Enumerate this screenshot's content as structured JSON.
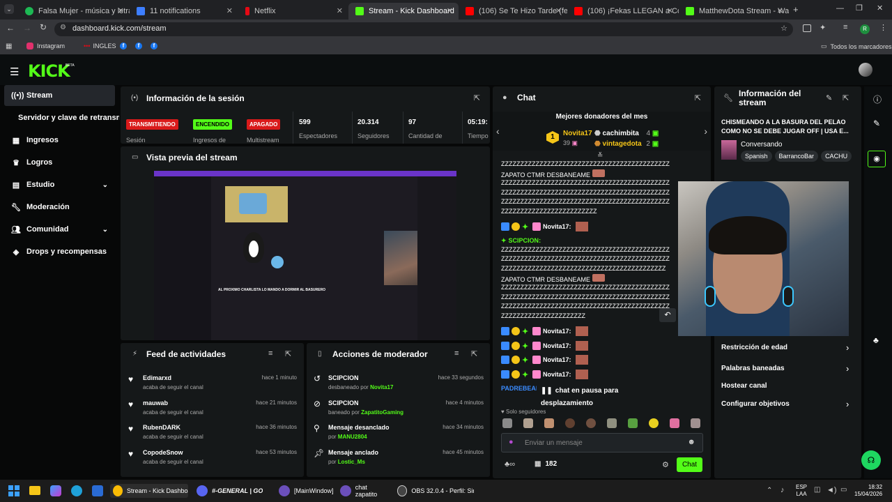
{
  "browser": {
    "tabs": [
      {
        "label": "Falsa Mujer - música y letra de",
        "color": "#1db954"
      },
      {
        "label": "11 notifications",
        "color": "#3d7eff"
      },
      {
        "label": "Netflix",
        "color": "#e50914"
      },
      {
        "label": "Stream - Kick Dashboard",
        "color": "#53fc18"
      },
      {
        "label": "(106) Se Te Hizo Tarde (feat. Ele",
        "color": "#ff0000"
      },
      {
        "label": "(106) ¡Fekas LLEGAN a Colo",
        "color": "#ff0000"
      },
      {
        "label": "MatthewDota Stream - Watch l",
        "color": "#53fc18"
      }
    ],
    "url": "dashboard.kick.com/stream",
    "bookmarks": [
      "Instagram",
      "INGLES"
    ],
    "bookmarks_right": "Todos los marcadores"
  },
  "brand": {
    "logo": "KICK",
    "beta": "BETA"
  },
  "sidebar": {
    "items": [
      {
        "label": "Stream",
        "icon": "broadcast-icon"
      },
      {
        "label": "Servidor y clave de retransmisión",
        "icon": ""
      },
      {
        "label": "Ingresos",
        "icon": "revenue-icon"
      },
      {
        "label": "Logros",
        "icon": "trophy-icon"
      },
      {
        "label": "Estudio",
        "icon": "studio-icon"
      },
      {
        "label": "Moderación",
        "icon": "wrench-icon"
      },
      {
        "label": "Comunidad",
        "icon": "community-icon"
      },
      {
        "label": "Drops y recompensas",
        "icon": "drops-icon"
      }
    ]
  },
  "session": {
    "title": "Información de la sesión",
    "status_badges": [
      {
        "badge": "TRANSMITIENDO",
        "label": "Sesión",
        "color": "#d91a1a"
      },
      {
        "badge": "ENCENDIDO",
        "label": "Ingresos de",
        "color": "#53fc18"
      },
      {
        "badge": "APAGADO",
        "label": "Multistream",
        "color": "#d91a1a"
      }
    ],
    "stats": [
      {
        "value": "599",
        "label": "Espectadores"
      },
      {
        "value": "20.314",
        "label": "Seguidores"
      },
      {
        "value": "97",
        "label": "Cantidad de"
      },
      {
        "value": "05:19:",
        "label": "Tiempo"
      }
    ]
  },
  "preview": {
    "title": "Vista previa del stream",
    "overlay_text": "AL PROXIMO CHARLISTA LO MANDO A DORMIR AL BASURERO"
  },
  "feed": {
    "title": "Feed de actividades",
    "rows": [
      {
        "name": "Edimarxd",
        "sub": "acaba de seguir el canal",
        "time": "hace 1 minuto"
      },
      {
        "name": "mauwab",
        "sub": "acaba de seguir el canal",
        "time": "hace 21 minutos"
      },
      {
        "name": "RubenDARK",
        "sub": "acaba de seguir el canal",
        "time": "hace 36 minutos"
      },
      {
        "name": "CopodeSnow",
        "sub": "acaba de seguir el canal",
        "time": "hace 53 minutos"
      }
    ]
  },
  "moderator": {
    "title": "Acciones de moderador",
    "rows": [
      {
        "name": "SCIPCION",
        "sub": "desbaneado por",
        "by": "Novita17",
        "time": "hace 33 segundos"
      },
      {
        "name": "SCIPCION",
        "sub": "baneado por",
        "by": "ZapatitoGaming",
        "time": "hace 4 minutos"
      },
      {
        "name": "Mensaje desanclado",
        "sub": "por",
        "by": "MANU2804",
        "time": "hace 34 minutos"
      },
      {
        "name": "Mensaje anclado",
        "sub": "por",
        "by": "Lostic_Ms",
        "time": "hace 45 minutos"
      }
    ]
  },
  "chat": {
    "title": "Chat",
    "donors_title": "Mejores donadores del mes",
    "donors": [
      {
        "name": "Novita17",
        "amount": "39"
      },
      {
        "name": "cachimbita",
        "amount": "4"
      },
      {
        "name": "vintagedota",
        "amount": "2"
      }
    ],
    "rank_badge": "1",
    "lines": [
      "ZZZZZZZZZZZZZZZZZZZZZZZZZZZZZZZZZZZZZZZZZZZZ",
      "ZAPATO CTMR DESBANEAME",
      "ZZZZZZZZZZZZZZZZZZZZZZZZZZZZZZZZZZZZZZZZZZZZ",
      "ZZZZZZZZZZZZZZZZZZZZZZZZZZZZZZZZZZZZZZZZZZZZ",
      "ZZZZZZZZZZZZZZZZZZZZZZZZZZZZZZZZZZZZZZZZZZZZ",
      "ZZZZZZZZZZZZZZZZZZZZZZZZZ"
    ],
    "mention": "SCIPCION",
    "lines2": [
      "ZZZZZZZZZZZZZZZZZZZZZZZZZZZZZZZZZZZZZZZZZZZZ",
      "ZZZZZZZZZZZZZZZZZZZZZZZZZZZZZZZZZZZZZZZZZZZZ",
      "ZZZZZZZZZZZZZZZZZZZZZZZZZZZZZZZZZZZZZZZZZZZ",
      "ZAPATO CTMR DESBANEAME",
      "ZZZZZZZZZZZZZZZZZZZZZZZZZZZZZZZZZZZZZZZZZZZZ",
      "ZZZZZZZZZZZZZZZZZZZZZZZZZZZZZZZZZZZZZZZZZZZZ",
      "ZZZZZZZZZZZZZZZZZZZZZZZZZZZZZZZZZZZZZZZZZZZZ",
      "ZZZZZZZZZZZZZZZZZZZZZZ"
    ],
    "user": "Novita17:",
    "partial_user": "PADREBEAR",
    "paused": "chat en pausa para desplazamiento",
    "followers_only": "Solo seguidores",
    "input_placeholder": "Enviar un mensaje",
    "count": "182",
    "send_label": "Chat"
  },
  "stream_info": {
    "title": "Información del stream",
    "stream_title": "CHISMEANDO A LA BASURA DEL PELAO COMO NO SE DEBE JUGAR OFF | USA E...",
    "category": "Conversando",
    "tags": [
      "Spanish",
      "BarrancoBar",
      "CACHU"
    ],
    "options": [
      {
        "label": "Restricción de edad",
        "arrow": true
      },
      {
        "label": "Palabras baneadas",
        "arrow": true
      },
      {
        "label": "Hostear canal",
        "arrow": false
      },
      {
        "label": "Configurar objetivos",
        "arrow": true
      }
    ]
  },
  "taskbar": {
    "apps": [
      {
        "label": "Stream - Kick Dashboard",
        "color": "#fbbc05"
      },
      {
        "label": "#-GENERAL | GO",
        "color": "#5865f2"
      },
      {
        "label": "[MainWindow]",
        "color": "#6b4fbb"
      },
      {
        "label": "chat zapatito",
        "color": "#6b4fbb"
      },
      {
        "label": "OBS 32.0.4 - Perfil: Sin T",
        "color": "#444"
      }
    ],
    "lang": "ESP",
    "lang2": "LAA",
    "time": "18:32",
    "date": "15/04/2026"
  }
}
